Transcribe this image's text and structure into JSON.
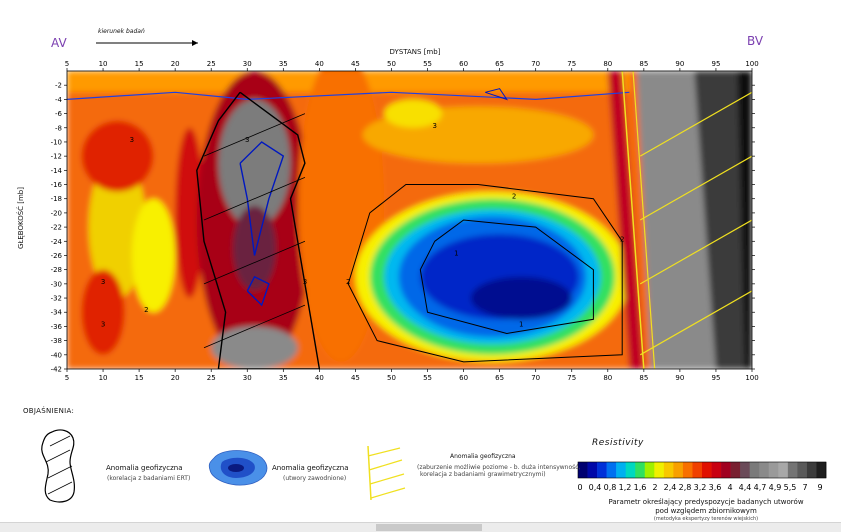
{
  "chart_data": {
    "type": "heatmap",
    "title": "",
    "direction_label": "kierunek badań",
    "left_end_label": "AV",
    "right_end_label": "BV",
    "xlabel": "DYSTANS [mb]",
    "ylabel": "GŁĘBOKOŚĆ [mb]",
    "xlim": [
      5,
      100
    ],
    "ylim": [
      -42,
      0
    ],
    "x_ticks": [
      "5",
      "10",
      "15",
      "20",
      "25",
      "30",
      "35",
      "40",
      "45",
      "50",
      "55",
      "60",
      "65",
      "70",
      "75",
      "80",
      "85",
      "90",
      "95",
      "100"
    ],
    "y_ticks": [
      "-2",
      "-4",
      "-6",
      "-8",
      "-10",
      "-12",
      "-14",
      "-16",
      "-18",
      "-20",
      "-22",
      "-24",
      "-26",
      "-28",
      "-30",
      "-32",
      "-34",
      "-36",
      "-38",
      "-40",
      "-42"
    ],
    "x_tick_values": [
      5,
      10,
      15,
      20,
      25,
      30,
      35,
      40,
      45,
      50,
      55,
      60,
      65,
      70,
      75,
      80,
      85,
      90,
      95,
      100
    ],
    "y_tick_values": [
      -2,
      -4,
      -6,
      -8,
      -10,
      -12,
      -14,
      -16,
      -18,
      -20,
      -22,
      -24,
      -26,
      -28,
      -30,
      -32,
      -34,
      -36,
      -38,
      -40,
      -42
    ],
    "contour_labels": [
      {
        "text": "3",
        "x": 14,
        "y": -10
      },
      {
        "text": "3",
        "x": 10,
        "y": -30
      },
      {
        "text": "3",
        "x": 10,
        "y": -36
      },
      {
        "text": "3",
        "x": 30,
        "y": -10
      },
      {
        "text": "3",
        "x": 38,
        "y": -30
      },
      {
        "text": "2",
        "x": 16,
        "y": -34
      },
      {
        "text": "2",
        "x": 44,
        "y": -30
      },
      {
        "text": "2",
        "x": 67,
        "y": -18
      },
      {
        "text": "2",
        "x": 82,
        "y": -24
      },
      {
        "text": "1",
        "x": 59,
        "y": -26
      },
      {
        "text": "1",
        "x": 68,
        "y": -36
      },
      {
        "text": "3",
        "x": 56,
        "y": -8
      }
    ],
    "legend": {
      "title": "Resistivity",
      "colors": [
        "#000070",
        "#0008a8",
        "#0030d8",
        "#0070f0",
        "#00b0f0",
        "#00d8c0",
        "#30e060",
        "#a0f000",
        "#f0f000",
        "#f8c800",
        "#f8a000",
        "#f87000",
        "#f04000",
        "#e01000",
        "#c80010",
        "#a00020",
        "#782030",
        "#6a4a58",
        "#7a7a7a",
        "#8a8a8a",
        "#9a9a9a",
        "#a8a8a8",
        "#747474",
        "#5a5a5a",
        "#3c3c3c",
        "#1e1e1e"
      ],
      "tick_labels": [
        "0",
        "0,4",
        "0,8",
        "1,2",
        "1,6",
        "2",
        "2,4",
        "2,8",
        "3,2",
        "3,6",
        "4",
        "4,4",
        "4,7",
        "4,9",
        "5,5",
        "7",
        "9"
      ],
      "caption": "Parametr określający predyspozycje badanych utworów pod względem zbiornikowym",
      "caption_line1": "Parametr określający predyspozycje badanych utworów",
      "caption_line2": "pod względem zbiornikowym",
      "caption_note": "(metodyka ekspertyzy terenów wiejskich)"
    },
    "annotations": {
      "heading": "OBJAŚNIENIA:",
      "item1_title": "Anomalia geofizyczna",
      "item1_note": "(korelacja z badaniami ERT)",
      "item2_title": "Anomalia geofizyczna",
      "item2_note": "(utwory zawodnione)",
      "item3_title": "Anomalia geofizyczna",
      "item3_note_line1": "(zaburzenie możliwie poziome - b. duża intensywność,",
      "item3_note_line2": "korelacja z badaniami grawimetrycznymi)",
      "item3_note_bold": "poziome"
    }
  }
}
